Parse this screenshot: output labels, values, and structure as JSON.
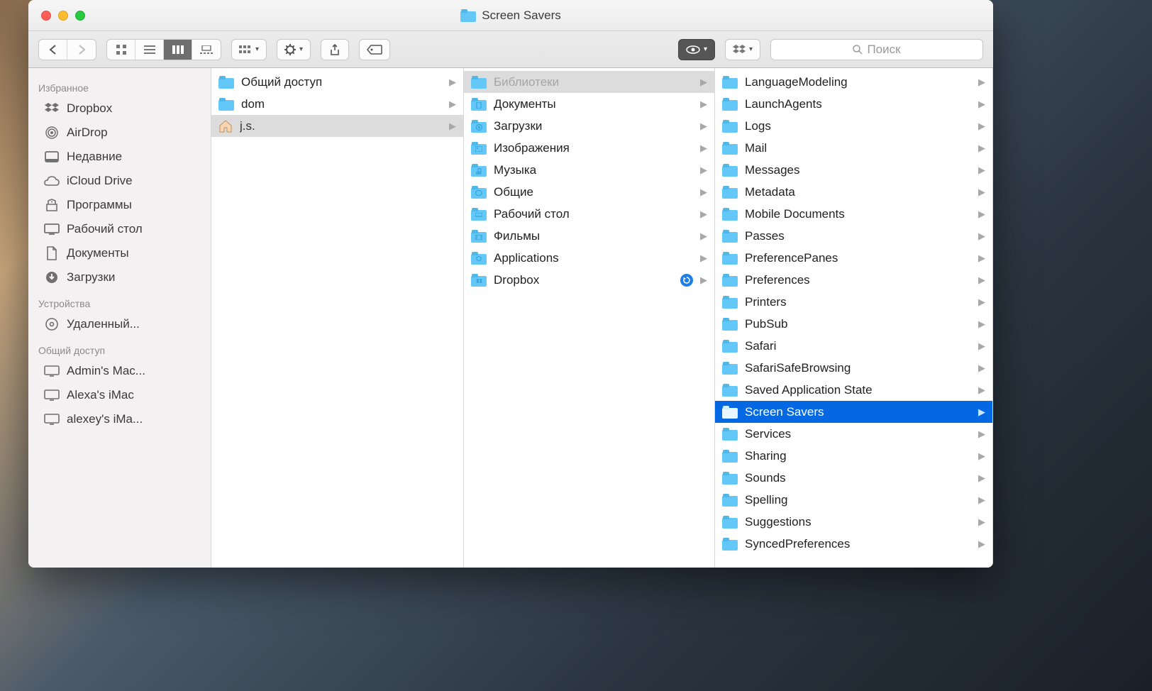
{
  "window": {
    "title": "Screen Savers"
  },
  "toolbar": {
    "search_placeholder": "Поиск"
  },
  "sidebar": {
    "sections": [
      {
        "header": "Избранное",
        "items": [
          {
            "label": "Dropbox",
            "icon": "dropbox"
          },
          {
            "label": "AirDrop",
            "icon": "airdrop"
          },
          {
            "label": "Недавние",
            "icon": "recents"
          },
          {
            "label": "iCloud Drive",
            "icon": "icloud"
          },
          {
            "label": "Программы",
            "icon": "apps"
          },
          {
            "label": "Рабочий стол",
            "icon": "desktop"
          },
          {
            "label": "Документы",
            "icon": "documents"
          },
          {
            "label": "Загрузки",
            "icon": "downloads"
          }
        ]
      },
      {
        "header": "Устройства",
        "items": [
          {
            "label": "Удаленный...",
            "icon": "disc"
          }
        ]
      },
      {
        "header": "Общий доступ",
        "items": [
          {
            "label": "Admin's Mac...",
            "icon": "computer"
          },
          {
            "label": "Alexa's iMac",
            "icon": "computer"
          },
          {
            "label": "alexey's iMa...",
            "icon": "computer"
          }
        ]
      }
    ]
  },
  "columns": [
    {
      "items": [
        {
          "label": "Общий доступ",
          "type": "folder"
        },
        {
          "label": "dom",
          "type": "folder"
        },
        {
          "label": "j.s.",
          "type": "home",
          "pathSelected": true
        }
      ]
    },
    {
      "items": [
        {
          "label": "Библиотеки",
          "type": "folder",
          "pathSelected": true,
          "dimmed": true
        },
        {
          "label": "Документы",
          "type": "folder",
          "glyph": "doc"
        },
        {
          "label": "Загрузки",
          "type": "folder",
          "glyph": "dl"
        },
        {
          "label": "Изображения",
          "type": "folder",
          "glyph": "img"
        },
        {
          "label": "Музыка",
          "type": "folder",
          "glyph": "music"
        },
        {
          "label": "Общие",
          "type": "folder",
          "glyph": "pub"
        },
        {
          "label": "Рабочий стол",
          "type": "folder",
          "glyph": "desk"
        },
        {
          "label": "Фильмы",
          "type": "folder",
          "glyph": "mov"
        },
        {
          "label": "Applications",
          "type": "folder",
          "glyph": "app"
        },
        {
          "label": "Dropbox",
          "type": "folder",
          "glyph": "dbx",
          "sync": true
        }
      ]
    },
    {
      "items": [
        {
          "label": "LanguageModeling",
          "type": "folder"
        },
        {
          "label": "LaunchAgents",
          "type": "folder"
        },
        {
          "label": "Logs",
          "type": "folder"
        },
        {
          "label": "Mail",
          "type": "folder"
        },
        {
          "label": "Messages",
          "type": "folder"
        },
        {
          "label": "Metadata",
          "type": "folder"
        },
        {
          "label": "Mobile Documents",
          "type": "folder"
        },
        {
          "label": "Passes",
          "type": "folder"
        },
        {
          "label": "PreferencePanes",
          "type": "folder"
        },
        {
          "label": "Preferences",
          "type": "folder"
        },
        {
          "label": "Printers",
          "type": "folder"
        },
        {
          "label": "PubSub",
          "type": "folder"
        },
        {
          "label": "Safari",
          "type": "folder"
        },
        {
          "label": "SafariSafeBrowsing",
          "type": "folder"
        },
        {
          "label": "Saved Application State",
          "type": "folder"
        },
        {
          "label": "Screen Savers",
          "type": "folder",
          "selected": true
        },
        {
          "label": "Services",
          "type": "folder"
        },
        {
          "label": "Sharing",
          "type": "folder"
        },
        {
          "label": "Sounds",
          "type": "folder"
        },
        {
          "label": "Spelling",
          "type": "folder"
        },
        {
          "label": "Suggestions",
          "type": "folder"
        },
        {
          "label": "SyncedPreferences",
          "type": "folder"
        }
      ]
    }
  ]
}
